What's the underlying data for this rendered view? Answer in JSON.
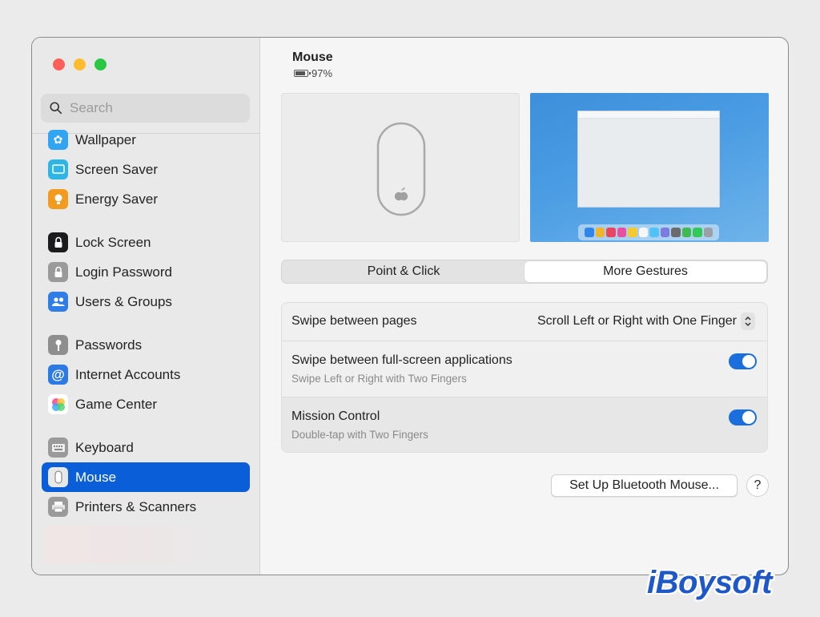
{
  "window": {
    "title": "Mouse",
    "battery": "97%"
  },
  "search": {
    "placeholder": "Search"
  },
  "sidebar": {
    "items": [
      {
        "label": "Wallpaper",
        "icon": "wallpaper-icon",
        "color": "#31a4f2"
      },
      {
        "label": "Screen Saver",
        "icon": "screen-saver-icon",
        "color": "#2fb4e6"
      },
      {
        "label": "Energy Saver",
        "icon": "energy-saver-icon",
        "color": "#f39b1e"
      },
      {
        "label": "Lock Screen",
        "icon": "lock-screen-icon",
        "color": "#1c1c1e"
      },
      {
        "label": "Login Password",
        "icon": "login-password-icon",
        "color": "#9a9a9a"
      },
      {
        "label": "Users & Groups",
        "icon": "users-groups-icon",
        "color": "#2f7de6"
      },
      {
        "label": "Passwords",
        "icon": "passwords-icon",
        "color": "#8e8e8e"
      },
      {
        "label": "Internet Accounts",
        "icon": "internet-accounts-icon",
        "color": "#2c7be5"
      },
      {
        "label": "Game Center",
        "icon": "game-center-icon",
        "color": "#ffffff"
      },
      {
        "label": "Keyboard",
        "icon": "keyboard-icon",
        "color": "#9a9a9a"
      },
      {
        "label": "Mouse",
        "icon": "mouse-icon",
        "color": "#e8e8e8",
        "active": true
      },
      {
        "label": "Printers & Scanners",
        "icon": "printer-icon",
        "color": "#9a9a9a"
      }
    ]
  },
  "tabs": {
    "point_click": "Point & Click",
    "more_gestures": "More Gestures",
    "selected": "More Gestures"
  },
  "settings": {
    "swipe_pages": {
      "label": "Swipe between pages",
      "value": "Scroll Left or Right with One Finger"
    },
    "swipe_fullscreen": {
      "label": "Swipe between full-screen applications",
      "sub": "Swipe Left or Right with Two Fingers",
      "on": true
    },
    "mission_control": {
      "label": "Mission Control",
      "sub": "Double-tap with Two Fingers",
      "on": true
    }
  },
  "buttons": {
    "bluetooth": "Set Up Bluetooth Mouse...",
    "help": "?"
  },
  "colors": {
    "accent": "#0a5fd8",
    "toggle_on": "#1a6fdc",
    "close": "#fe5f57",
    "minimize": "#febc2e",
    "maximize": "#28c840",
    "watermark": "#1e58c8"
  },
  "dock_colors": [
    "#2f86e8",
    "#f2b42a",
    "#e8475f",
    "#e94f9f",
    "#f5c930",
    "#f6f6f6",
    "#4fc3f7",
    "#7b7be0",
    "#6b6b6b",
    "#3fb950",
    "#34c759",
    "#9aa0a6"
  ],
  "watermark": "iBoysoft"
}
